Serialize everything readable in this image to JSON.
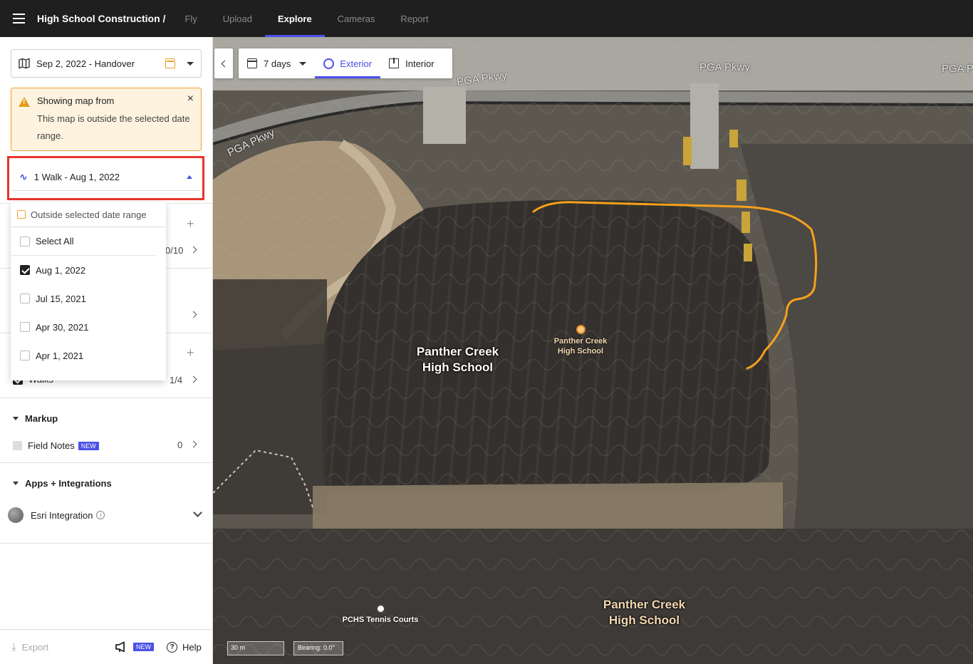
{
  "header": {
    "project_title": "High School Construction /",
    "tabs": [
      "Fly",
      "Upload",
      "Explore",
      "Cameras",
      "Report"
    ],
    "active_tab": "Explore"
  },
  "sidebar": {
    "date_select": {
      "label": "Sep 2, 2022 - Handover"
    },
    "warning": {
      "title": "Showing map from",
      "body": "This map is outside the selected date range."
    },
    "walk_select": {
      "label": "1 Walk - Aug 1, 2022"
    },
    "dropdown": {
      "header": "Outside selected date range",
      "select_all": "Select All",
      "options": [
        {
          "label": "Aug 1, 2022",
          "checked": true
        },
        {
          "label": "Jul 15, 2021",
          "checked": false
        },
        {
          "label": "Apr 30, 2021",
          "checked": false
        },
        {
          "label": "Apr 1, 2021",
          "checked": false
        }
      ]
    },
    "partial_count_1": "0/10",
    "walks_count": "1/4",
    "walks_partial_label": "Walks",
    "markup": {
      "title": "Markup",
      "field_notes_label": "Field Notes",
      "field_notes_badge": "NEW",
      "field_notes_count": "0"
    },
    "apps": {
      "title": "Apps + Integrations",
      "esri_label": "Esri Integration"
    },
    "footer": {
      "export_label": "Export",
      "new_badge": "NEW",
      "help_label": "Help"
    }
  },
  "map_toolbar": {
    "range_label": "7 days",
    "exterior_label": "Exterior",
    "interior_label": "Interior"
  },
  "map": {
    "road_labels": [
      "PGA Pkwy",
      "PGA Pkwy",
      "PGA Pkwy",
      "PGA P"
    ],
    "big_label_1": "Panther Creek High School",
    "big_label_2": "Panther Creek High School",
    "poi_school": "Panther Creek High School",
    "poi_courts": "PCHS Tennis Courts",
    "scale": "30 m",
    "bearing": "Bearing: 0.0°",
    "walk_path_color": "#f7a11a"
  },
  "colors": {
    "accent": "#4a50e8",
    "warning": "#f0a030",
    "highlight": "#e8342b"
  }
}
